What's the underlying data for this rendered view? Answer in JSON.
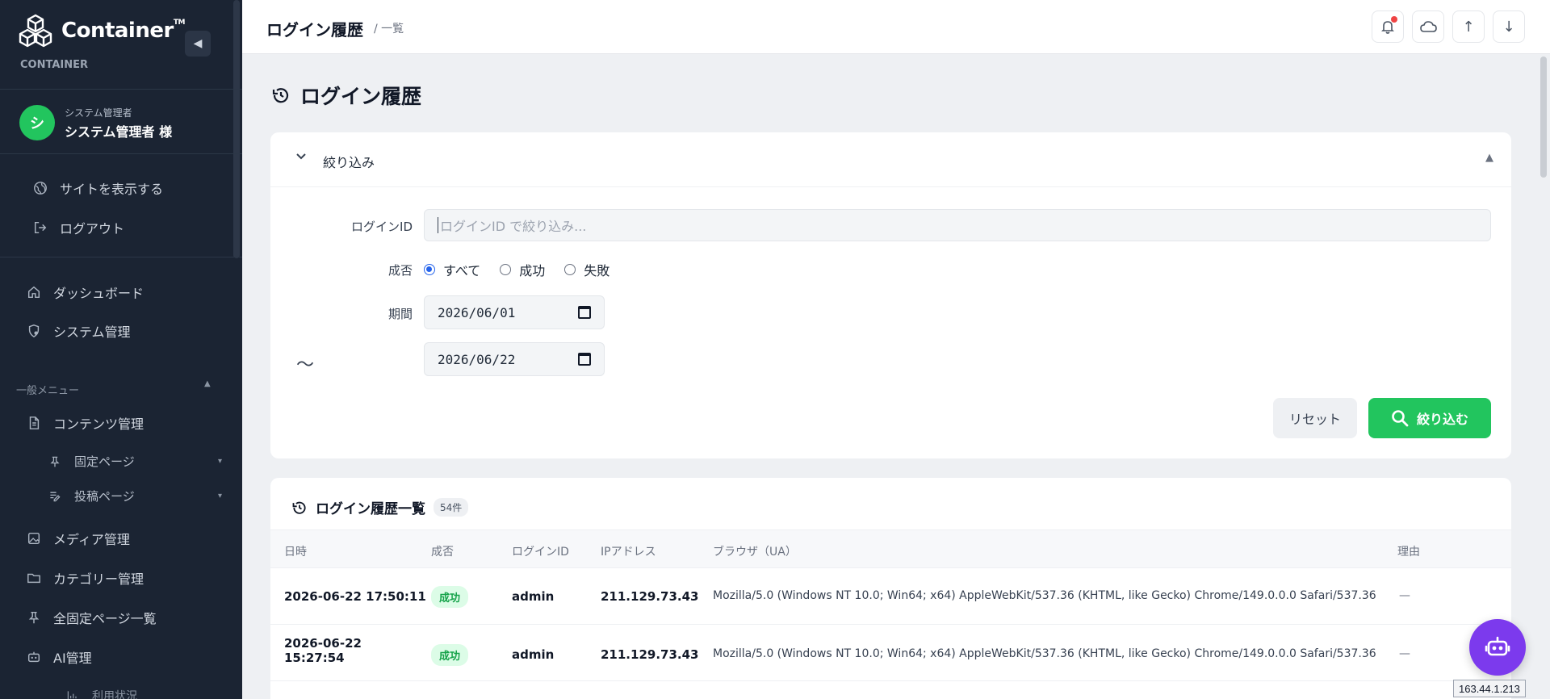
{
  "brand": {
    "name": "Container",
    "tm": "TM",
    "sub": "CONTAINER"
  },
  "user": {
    "initial": "シ",
    "role": "システム管理者",
    "name": "システム管理者 様"
  },
  "sidebar": {
    "view_site": "サイトを表示する",
    "logout": "ログアウト",
    "dashboard": "ダッシュボード",
    "system": "システム管理",
    "section": "一般メニュー",
    "content": "コンテンツ管理",
    "fixed_pages": "固定ページ",
    "posts": "投稿ページ",
    "media": "メディア管理",
    "category": "カテゴリー管理",
    "all_fixed": "全固定ページ一覧",
    "ai": "AI管理",
    "usage": "利用状況"
  },
  "header": {
    "title": "ログイン履歴",
    "sub": "/ 一覧"
  },
  "page": {
    "title": "ログイン履歴"
  },
  "filter": {
    "heading": "絞り込み",
    "login_id_label": "ログインID",
    "login_id_placeholder": "ログインID で絞り込み...",
    "result_label": "成否",
    "opt_all": "すべて",
    "opt_success": "成功",
    "opt_fail": "失敗",
    "period_label": "期間",
    "date_from": "2026/06/01",
    "tilde": "〜",
    "date_to": "2026/06/22",
    "reset": "リセット",
    "submit": "絞り込む"
  },
  "list": {
    "title": "ログイン履歴一覧",
    "count": "54件",
    "columns": {
      "datetime": "日時",
      "result": "成否",
      "login_id": "ログインID",
      "ip": "IPアドレス",
      "browser": "ブラウザ（UA）",
      "reason": "理由"
    },
    "rows": [
      {
        "datetime": "2026-06-22 17:50:11",
        "result": "成功",
        "login_id": "admin",
        "ip": "211.129.73.43",
        "ua": "Mozilla/5.0 (Windows NT 10.0; Win64; x64) AppleWebKit/537.36 (KHTML, like Gecko) Chrome/149.0.0.0 Safari/537.36",
        "reason": "—"
      },
      {
        "datetime_l1": "2026-06-22",
        "datetime_l2": "15:27:54",
        "result": "成功",
        "login_id": "admin",
        "ip": "211.129.73.43",
        "ua": "Mozilla/5.0 (Windows NT 10.0; Win64; x64) AppleWebKit/537.36 (KHTML, like Gecko) Chrome/149.0.0.0 Safari/537.36",
        "reason": "—"
      }
    ]
  },
  "tooltip": {
    "ip": "163.44.1.213"
  },
  "colors": {
    "sidebar_bg": "#1b2433",
    "accent_green": "#22c55e",
    "bot_purple": "#7c3aed"
  }
}
